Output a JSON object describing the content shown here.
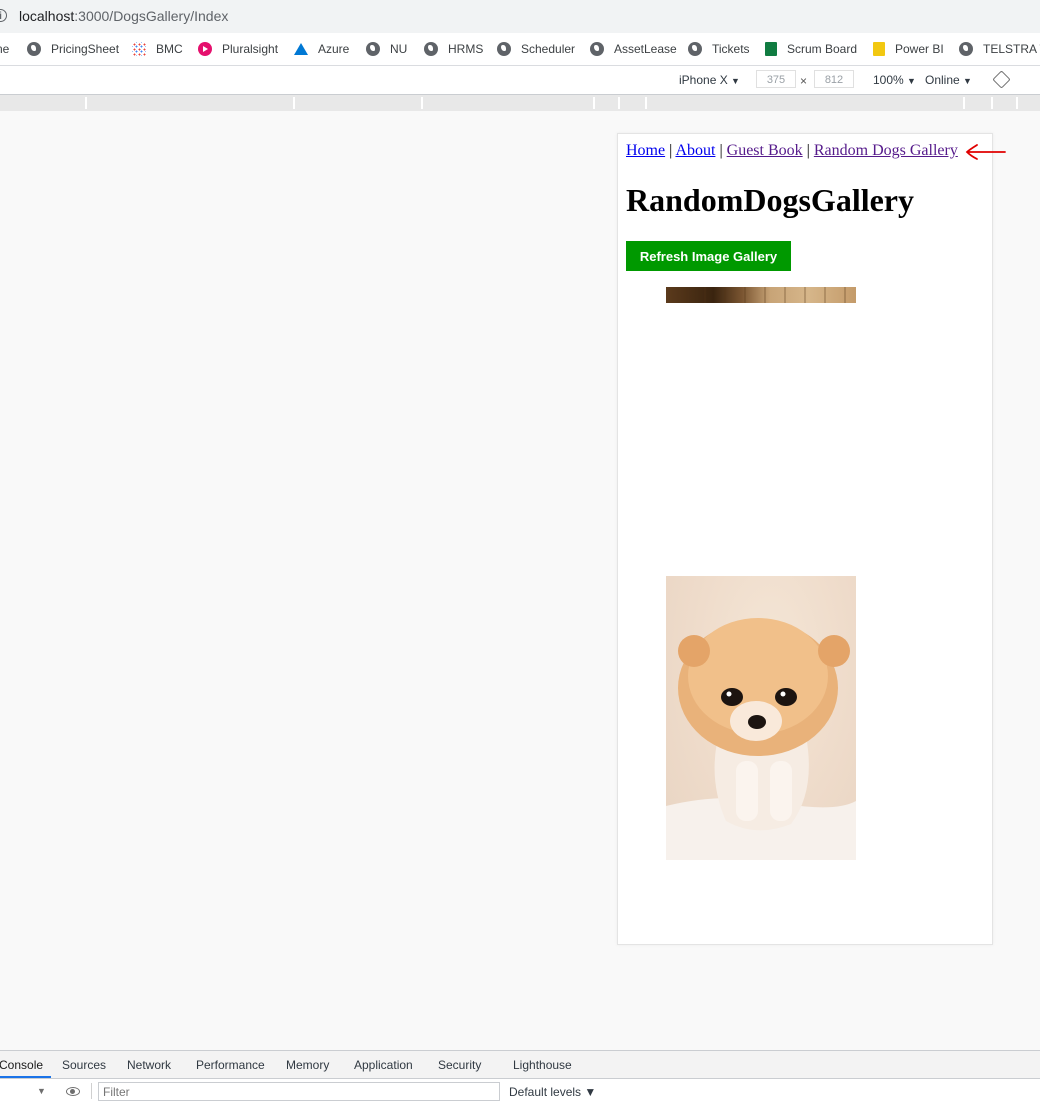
{
  "browser": {
    "url_host": "localhost",
    "url_path": ":3000/DogsGallery/Index",
    "info_glyph": "i"
  },
  "bookmarks": [
    {
      "label": "ne",
      "icon": "none"
    },
    {
      "label": "PricingSheet",
      "icon": "globe-icon"
    },
    {
      "label": "BMC",
      "icon": "bmc-dots-icon"
    },
    {
      "label": "Pluralsight",
      "icon": "pluralsight-icon"
    },
    {
      "label": "Azure",
      "icon": "azure-icon"
    },
    {
      "label": "NU",
      "icon": "globe-icon"
    },
    {
      "label": "HRMS",
      "icon": "globe-icon"
    },
    {
      "label": "Scheduler",
      "icon": "globe-icon"
    },
    {
      "label": "AssetLease",
      "icon": "globe-icon"
    },
    {
      "label": "Tickets",
      "icon": "globe-icon"
    },
    {
      "label": "Scrum Board",
      "icon": "scrum-board-icon"
    },
    {
      "label": "Power BI",
      "icon": "power-bi-icon"
    },
    {
      "label": "TELSTRA T",
      "icon": "globe-icon"
    }
  ],
  "device_toolbar": {
    "device": "iPhone X",
    "width": "375",
    "times": "×",
    "height": "812",
    "zoom": "100%",
    "network": "Online",
    "dropdown_glyph": "▼"
  },
  "page": {
    "nav": {
      "home": "Home",
      "about": "About",
      "guestbook": "Guest Book",
      "gallery": "Random Dogs Gallery",
      "separator": "|"
    },
    "title": "RandomDogsGallery",
    "refresh_button": "Refresh Image Gallery"
  },
  "devtools": {
    "tabs": [
      "Console",
      "Sources",
      "Network",
      "Performance",
      "Memory",
      "Application",
      "Security",
      "Lighthouse"
    ],
    "active_tab": "Console",
    "filter_placeholder": "Filter",
    "levels": "Default levels ▼"
  },
  "colors": {
    "button_green": "#009900",
    "link": "#0000ee",
    "visited_link": "#551a8b",
    "annotation": "#e00000"
  }
}
